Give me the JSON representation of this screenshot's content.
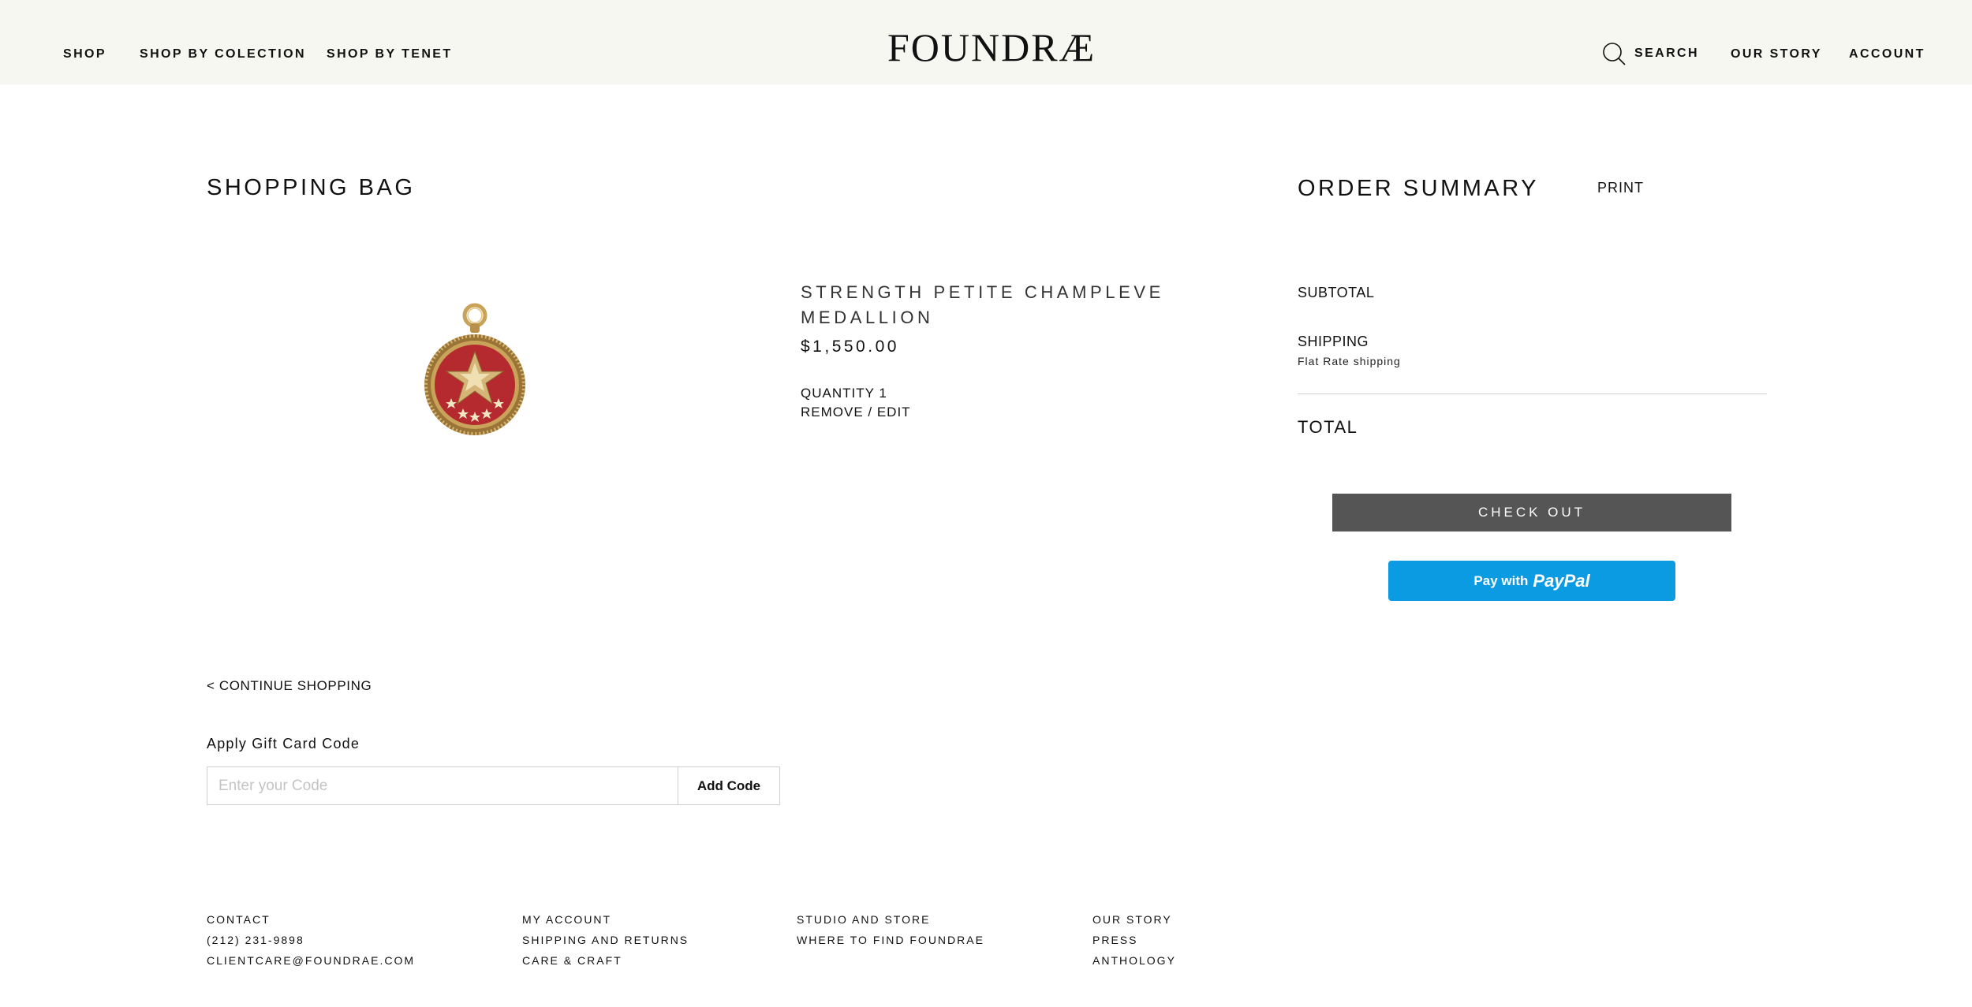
{
  "header": {
    "nav_left": [
      "SHOP",
      "SHOP BY COLECTION",
      "SHOP BY TENET"
    ],
    "logo": "FOUNDRÆ",
    "search_label": "SEARCH",
    "nav_right": [
      "OUR STORY",
      "ACCOUNT"
    ]
  },
  "bag": {
    "title": "SHOPPING BAG",
    "item": {
      "name": "STRENGTH PETITE CHAMPLEVE MEDALLION",
      "price": "$1,550.00",
      "quantity": "QUANTITY 1",
      "remove_edit": "REMOVE / EDIT",
      "image_icon": "medallion-image"
    },
    "continue_shopping": "< CONTINUE SHOPPING",
    "gift_card": {
      "label": "Apply Gift Card Code",
      "placeholder": "Enter your Code",
      "value": "",
      "button": "Add Code"
    }
  },
  "summary": {
    "title": "ORDER SUMMARY",
    "print": "PRINT",
    "subtotal_label": "SUBTOTAL",
    "shipping_label": "SHIPPING",
    "shipping_method": "Flat Rate shipping",
    "total_label": "TOTAL",
    "checkout_button": "CHECK OUT",
    "paypal_prefix": "Pay with",
    "paypal_brand": "PayPal"
  },
  "footer": {
    "col1": [
      "CONTACT",
      "(212) 231-9898",
      "CLIENTCARE@FOUNDRAE.COM"
    ],
    "col2": [
      "MY ACCOUNT",
      "SHIPPING AND RETURNS",
      "CARE & CRAFT"
    ],
    "col3": [
      "STUDIO AND STORE",
      "WHERE TO FIND FOUNDRAE"
    ],
    "col4": [
      "OUR STORY",
      "PRESS",
      "ANTHOLOGY"
    ]
  },
  "colors": {
    "header_bg": "#f7f7f2",
    "checkout_bg": "#555555",
    "paypal_bg": "#0a9be2",
    "medallion_red": "#b52a2e",
    "gold": "#b8904a"
  }
}
